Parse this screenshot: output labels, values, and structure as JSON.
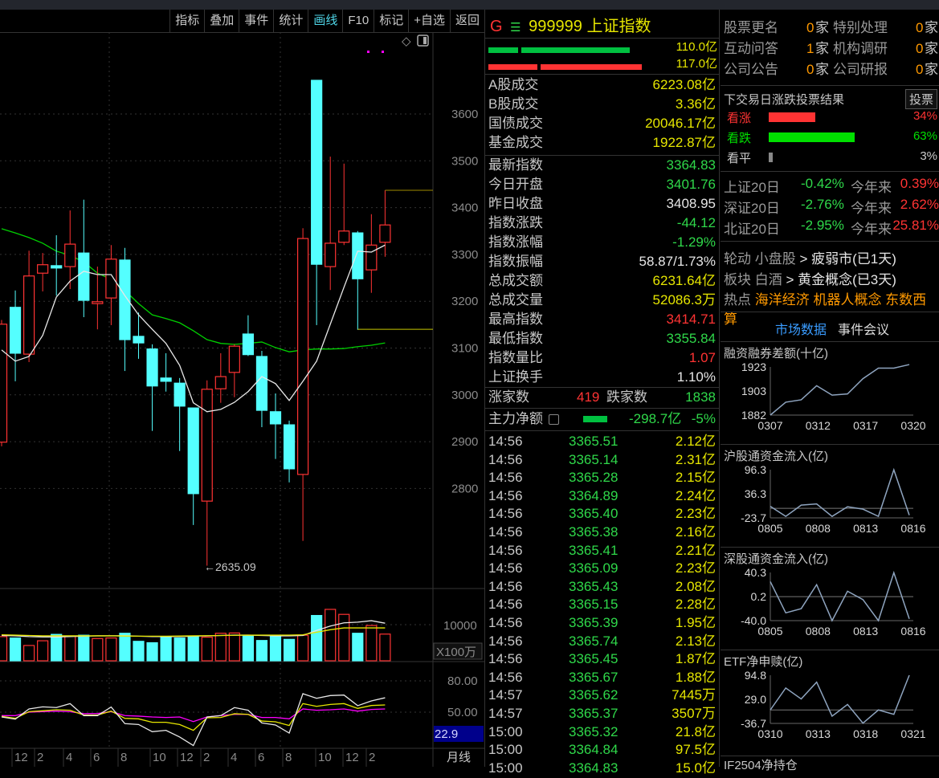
{
  "toolbar": {
    "buttons": [
      "指标",
      "叠加",
      "事件",
      "统计",
      "画线",
      "F10",
      "标记",
      "+自选",
      "返回"
    ],
    "active_index": 4
  },
  "main_chart": {
    "low_marker": "←2635.09",
    "period": "月线",
    "volume_unit": "X100万",
    "indicator_value": "22.9"
  },
  "quote": {
    "header": {
      "g": "G",
      "menu": "☰",
      "code": "999999",
      "name": "上证指数"
    },
    "flow_bars": [
      {
        "value": "110.0亿",
        "color": "#00c040",
        "fill": 0.8
      },
      {
        "value": "117.0亿",
        "color": "#ff3333",
        "fill": 0.87
      }
    ],
    "turnover": [
      {
        "label": "A股成交",
        "value": "6223.08亿",
        "cls": "y"
      },
      {
        "label": "B股成交",
        "value": "3.36亿",
        "cls": "y"
      },
      {
        "label": "国债成交",
        "value": "20046.17亿",
        "cls": "y"
      },
      {
        "label": "基金成交",
        "value": "1922.87亿",
        "cls": "y"
      }
    ],
    "stats": [
      {
        "label": "最新指数",
        "value": "3364.83",
        "cls": "g"
      },
      {
        "label": "今日开盘",
        "value": "3401.76",
        "cls": "g"
      },
      {
        "label": "昨日收盘",
        "value": "3408.95",
        "cls": "w"
      },
      {
        "label": "指数涨跌",
        "value": "-44.12",
        "cls": "g"
      },
      {
        "label": "指数涨幅",
        "value": "-1.29%",
        "cls": "g"
      },
      {
        "label": "指数振幅",
        "value": "58.87/1.73%",
        "cls": "w"
      },
      {
        "label": "总成交额",
        "value": "6231.64亿",
        "cls": "y"
      },
      {
        "label": "总成交量",
        "value": "52086.3万",
        "cls": "y"
      },
      {
        "label": "最高指数",
        "value": "3414.71",
        "cls": "rd"
      },
      {
        "label": "最低指数",
        "value": "3355.84",
        "cls": "g"
      },
      {
        "label": "指数量比",
        "value": "1.07",
        "cls": "rd"
      },
      {
        "label": "上证换手",
        "value": "1.10%",
        "cls": "w"
      }
    ],
    "breadth": {
      "up_label": "涨家数",
      "up": "419",
      "down_label": "跌家数",
      "down": "1838"
    },
    "main_flow": {
      "label": "主力净额",
      "amount": "-298.7亿",
      "pct": "-5%"
    },
    "ticks": [
      [
        "14:56",
        "3365.51",
        "2.12亿"
      ],
      [
        "14:56",
        "3365.14",
        "2.31亿"
      ],
      [
        "14:56",
        "3365.28",
        "2.15亿"
      ],
      [
        "14:56",
        "3364.89",
        "2.24亿"
      ],
      [
        "14:56",
        "3365.40",
        "2.23亿"
      ],
      [
        "14:56",
        "3365.38",
        "2.16亿"
      ],
      [
        "14:56",
        "3365.41",
        "2.21亿"
      ],
      [
        "14:56",
        "3365.09",
        "2.23亿"
      ],
      [
        "14:56",
        "3365.43",
        "2.08亿"
      ],
      [
        "14:56",
        "3365.15",
        "2.28亿"
      ],
      [
        "14:56",
        "3365.39",
        "1.95亿"
      ],
      [
        "14:56",
        "3365.74",
        "2.13亿"
      ],
      [
        "14:56",
        "3365.45",
        "1.87亿"
      ],
      [
        "14:56",
        "3365.67",
        "1.88亿"
      ],
      [
        "14:57",
        "3365.62",
        "7445万"
      ],
      [
        "14:57",
        "3365.37",
        "3507万"
      ],
      [
        "15:00",
        "3365.32",
        "21.8亿"
      ],
      [
        "15:00",
        "3364.84",
        "97.5亿"
      ],
      [
        "15:00",
        "3364.83",
        "15.0亿"
      ]
    ]
  },
  "events": [
    {
      "a": "股票更名",
      "an": "0",
      "b": "特别处理",
      "bn": "0"
    },
    {
      "a": "互动问答",
      "an": "1",
      "b": "机构调研",
      "bn": "0"
    },
    {
      "a": "公司公告",
      "an": "0",
      "b": "公司研报",
      "bn": "0"
    }
  ],
  "event_unit": "家",
  "vote": {
    "title": "下交易日涨跌投票结果",
    "button": "投票",
    "items": [
      {
        "label": "看涨",
        "pct": "34%",
        "fill": 0.34,
        "color": "#ff3333"
      },
      {
        "label": "看跌",
        "pct": "63%",
        "fill": 0.63,
        "color": "#00e000"
      },
      {
        "label": "看平",
        "pct": "3%",
        "fill": 0.03,
        "color": "#888888"
      }
    ]
  },
  "indices": [
    {
      "label": "上证20日",
      "d20": "-0.42%",
      "ytd_label": "今年来",
      "ytd": "0.39%"
    },
    {
      "label": "深证20日",
      "d20": "-2.76%",
      "ytd_label": "今年来",
      "ytd": "2.62%"
    },
    {
      "label": "北证20日",
      "d20": "-2.95%",
      "ytd_label": "今年来",
      "ytd": "25.81%"
    }
  ],
  "market": {
    "rotation": {
      "label": "轮动",
      "from": "小盘股",
      "arrow": ">",
      "to": "疲弱市(已1天)"
    },
    "sector": {
      "label": "板块",
      "from": "白酒",
      "arrow": ">",
      "to": "黄金概念(已3天)"
    },
    "hot": {
      "label": "热点",
      "items": "海洋经济 机器人概念 东数西算"
    }
  },
  "tabs": {
    "market_data": "市场数据",
    "events": "事件会议"
  },
  "next_title": "IF2504净持仓",
  "chart_data": [
    {
      "type": "candlestick",
      "title": "上证指数 月线",
      "ylim": [
        2560,
        3700
      ],
      "yticks": [
        "3600",
        "3500",
        "3400",
        "3300",
        "3200",
        "3100",
        "3000",
        "2900",
        "2800"
      ],
      "ytick_values": [
        3600,
        3500,
        3400,
        3300,
        3200,
        3100,
        3000,
        2900,
        2800
      ],
      "xtick_labels": [
        "12",
        "2",
        "4",
        "6",
        "8",
        "10",
        "12",
        "2",
        "4",
        "6",
        "8",
        "10",
        "12",
        "2"
      ],
      "ohlc": [
        [
          2899,
          3160,
          2890,
          3151
        ],
        [
          3187,
          3223,
          3029,
          3089
        ],
        [
          3087,
          3308,
          3070,
          3254
        ],
        [
          3260,
          3303,
          3221,
          3278
        ],
        [
          3276,
          3341,
          3212,
          3271
        ],
        [
          3274,
          3394,
          3226,
          3322
        ],
        [
          3303,
          3417,
          3166,
          3202
        ],
        [
          3195,
          3274,
          3140,
          3199
        ],
        [
          3207,
          3320,
          3149,
          3290
        ],
        [
          3288,
          3314,
          3051,
          3118
        ],
        [
          3125,
          3176,
          3077,
          3111
        ],
        [
          3098,
          3108,
          2923,
          3019
        ],
        [
          3036,
          3089,
          3007,
          3029
        ],
        [
          3025,
          3036,
          2880,
          2976
        ],
        [
          2972,
          2972,
          2722,
          2789
        ],
        [
          2773,
          3031,
          2635.09,
          3012
        ],
        [
          3013,
          3089,
          2983,
          3039
        ],
        [
          3048,
          3108,
          2995,
          3104
        ],
        [
          3130,
          3170,
          3083,
          3086
        ],
        [
          3082,
          3094,
          2931,
          2967
        ],
        [
          2964,
          3003,
          2863,
          2938
        ],
        [
          2936,
          2945,
          2813,
          2842
        ],
        [
          2830,
          3356,
          2688,
          3334
        ],
        [
          3672,
          3672,
          3149,
          3279
        ],
        [
          3274,
          3509,
          3224,
          3324
        ],
        [
          3326,
          3494,
          3320,
          3350
        ],
        [
          3346,
          3350,
          3139,
          3248
        ],
        [
          3267,
          3386,
          3218,
          3320
        ],
        [
          3326,
          3437,
          3295,
          3363
        ]
      ],
      "ma_white": [
        3096,
        3072,
        3082,
        3127,
        3209,
        3243,
        3264,
        3257,
        3257,
        3212,
        3171,
        3140,
        3110,
        3063,
        2983,
        2964,
        2969,
        2984,
        3007,
        3039,
        3024,
        2988,
        3029,
        3072,
        3151,
        3230,
        3307,
        3305,
        3320
      ],
      "ma_green": [
        3355,
        3346,
        3336,
        3324,
        3307,
        3298,
        3284,
        3260,
        3247,
        3223,
        3195,
        3171,
        3163,
        3154,
        3137,
        3118,
        3110,
        3108,
        3110,
        3113,
        3101,
        3092,
        3096,
        3098,
        3098,
        3099,
        3103,
        3106,
        3111
      ],
      "high_marker": 3437,
      "low_marker": 3140,
      "low_label": "2635.09"
    },
    {
      "type": "bar",
      "title": "成交量",
      "unit": "X100万",
      "ytick": "10000",
      "values": [
        6692,
        6308,
        4231,
        5538,
        7308,
        6846,
        7077,
        6154,
        6308,
        7615,
        5385,
        5000,
        6538,
        6308,
        6692,
        6538,
        7615,
        7692,
        7077,
        5615,
        6692,
        5923,
        7077,
        12538,
        14231,
        12846,
        7615,
        9769,
        7385
      ],
      "ma1": [
        7000,
        6900,
        6700,
        6600,
        6600,
        6700,
        6800,
        6900,
        6900,
        6950,
        6800,
        6700,
        6700,
        6700,
        6800,
        6900,
        7000,
        7100,
        7100,
        7000,
        6900,
        6900,
        7000,
        8400,
        9600,
        10500,
        10700,
        11100,
        10400
      ],
      "ma2": [
        7200,
        7100,
        7000,
        6900,
        6900,
        6900,
        6900,
        6900,
        6900,
        6850,
        6800,
        6800,
        6800,
        6850,
        6900,
        6950,
        7000,
        7050,
        7100,
        7100,
        7100,
        7100,
        7200,
        7900,
        8600,
        9100,
        9100,
        9100,
        9100
      ]
    },
    {
      "type": "line",
      "title": "指标",
      "yticks": [
        "80.00",
        "50.00"
      ],
      "ytick_values": [
        80,
        50
      ],
      "series": [
        {
          "name": "white",
          "color": "#e8e8e8",
          "values": [
            45.4,
            43.3,
            53.1,
            55.1,
            54.4,
            58.2,
            46.7,
            46.7,
            54.9,
            39,
            38.2,
            31.3,
            32.6,
            26.2,
            18,
            45.4,
            46.7,
            54.4,
            51.8,
            39.7,
            37.7,
            30,
            67.7,
            63.3,
            65.9,
            66.4,
            56.2,
            60.8,
            63.8
          ]
        },
        {
          "name": "yellow",
          "color": "#e6e600",
          "values": [
            45.9,
            44.1,
            50.5,
            51.3,
            52.3,
            51.8,
            47.2,
            47.2,
            51,
            44.1,
            43.6,
            40.3,
            40.3,
            38.2,
            32.6,
            44.6,
            44.9,
            48.5,
            47.9,
            41.5,
            40.8,
            37.2,
            58.2,
            55.6,
            57.4,
            58.2,
            53.6,
            56.4,
            56.9
          ]
        },
        {
          "name": "magenta",
          "color": "#ff00ff",
          "values": [
            46.7,
            46.7,
            50,
            50.5,
            51,
            50.5,
            48.5,
            48.7,
            50.5,
            46.7,
            46.2,
            45.4,
            44.9,
            45.4,
            41,
            45.4,
            46.7,
            47.9,
            47.9,
            44.9,
            44.9,
            43.6,
            53.1,
            51.8,
            52.3,
            53.1,
            51,
            52.6,
            53.1
          ]
        }
      ]
    },
    {
      "type": "line",
      "title": "融资融券差额(十亿)",
      "yticks": [
        "1923",
        "1903",
        "1882"
      ],
      "ylim": [
        1882,
        1923
      ],
      "xticks": [
        "0307",
        "0312",
        "0317",
        "0320"
      ],
      "zero_line": false,
      "values": [
        1882,
        1893,
        1895,
        1907,
        1899,
        1900,
        1913,
        1922,
        1922,
        1925
      ]
    },
    {
      "type": "line",
      "title": "沪股通资金流入(亿)",
      "yticks": [
        "96.3",
        "36.3",
        "-23.7"
      ],
      "ylim": [
        -23.7,
        96.3
      ],
      "xticks": [
        "0805",
        "0808",
        "0813",
        "0816"
      ],
      "zero_line": true,
      "values": [
        5,
        -20,
        8,
        11,
        -20,
        4,
        -2,
        -20,
        96,
        -17
      ]
    },
    {
      "type": "line",
      "title": "深股通资金流入(亿)",
      "yticks": [
        "40.3",
        "0.2",
        "-40.0"
      ],
      "ylim": [
        -40,
        40.3
      ],
      "xticks": [
        "0805",
        "0808",
        "0813",
        "0816"
      ],
      "zero_line": true,
      "values": [
        25,
        -27,
        -20,
        20,
        -40,
        9,
        -5,
        -40,
        40,
        -37
      ]
    },
    {
      "type": "line",
      "title": "ETF净申赎(亿)",
      "yticks": [
        "94.8",
        "29.0",
        "-36.7"
      ],
      "ylim": [
        -36.7,
        94.8
      ],
      "xticks": [
        "0310",
        "0313",
        "0318",
        "0321"
      ],
      "zero_line": true,
      "values": [
        0,
        60,
        30,
        76,
        -17,
        15,
        -36,
        0,
        -12,
        94.8
      ]
    }
  ]
}
